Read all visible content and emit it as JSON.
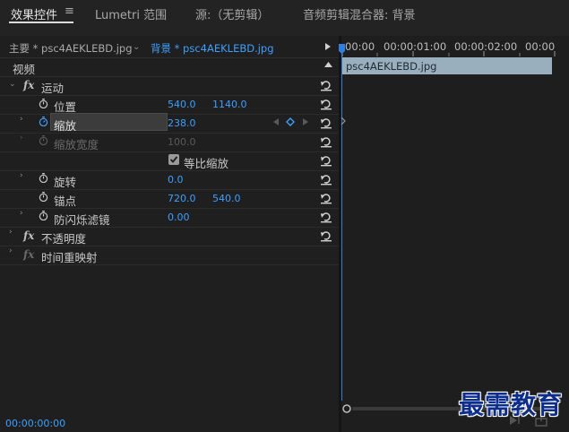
{
  "tabs": {
    "effects_controls": "效果控件",
    "lumetri": "Lumetri 范围",
    "source": "源:（无剪辑）",
    "mixer": "音频剪辑混合器: 背景"
  },
  "clip_header": {
    "master": "主要 * psc4AEKLEBD.jpg",
    "sequence": "背景 * psc4AEKLEBD.jpg"
  },
  "section": "视频",
  "effects": {
    "motion": "运动",
    "opacity": "不透明度",
    "time_remap": "时间重映射"
  },
  "properties": {
    "position": {
      "label": "位置",
      "x": "540.0",
      "y": "1140.0"
    },
    "scale": {
      "label": "缩放",
      "value": "238.0"
    },
    "scale_width": {
      "label": "缩放宽度",
      "value": "100.0"
    },
    "uniform_scale": {
      "label": "等比缩放",
      "checked": true
    },
    "rotation": {
      "label": "旋转",
      "value": "0.0"
    },
    "anchor": {
      "label": "锚点",
      "x": "720.0",
      "y": "540.0"
    },
    "antiflicker": {
      "label": "防闪烁滤镜",
      "value": "0.00"
    }
  },
  "timeline": {
    "ruler": [
      "00:00",
      "00:00:01:00",
      "00:00:02:00",
      "00:00"
    ],
    "clip": "psc4AEKLEBD.jpg"
  },
  "timecode": "00:00:00:00",
  "watermark": "最需教育",
  "colors": {
    "accent": "#3f9fff",
    "clip": "#9aafbd",
    "panel": "#1f1f1f"
  }
}
